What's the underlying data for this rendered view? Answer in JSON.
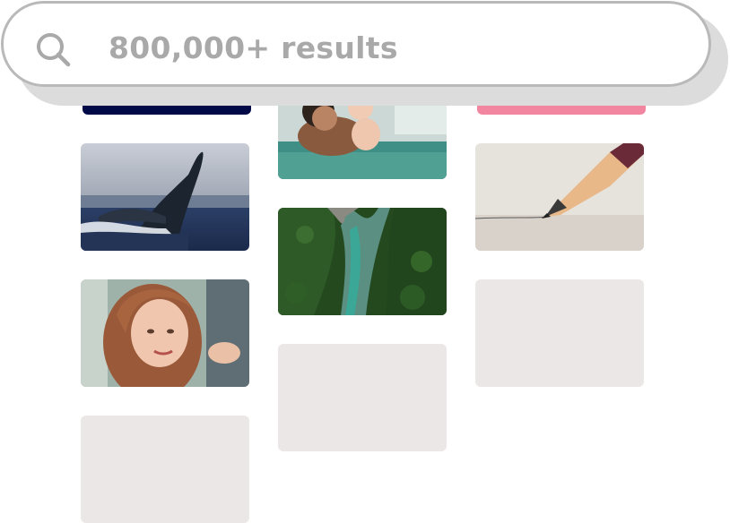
{
  "search": {
    "text": "800,000+ results",
    "icon": "search-icon"
  },
  "tiles": [
    {
      "name": "tile-navy",
      "kind": "color",
      "color": "#000948"
    },
    {
      "name": "tile-pink",
      "kind": "color",
      "color": "#f2859f"
    },
    {
      "name": "tile-whale",
      "kind": "image",
      "subject": "humpback whale breaching"
    },
    {
      "name": "tile-pool",
      "kind": "image",
      "subject": "father and baby in swimming pool"
    },
    {
      "name": "tile-pencil",
      "kind": "image",
      "subject": "pencil drawing a line"
    },
    {
      "name": "tile-river",
      "kind": "image",
      "subject": "aerial view of river through forest"
    },
    {
      "name": "tile-woman",
      "kind": "image",
      "subject": "woman with curly hair at salon"
    },
    {
      "name": "tile-placeholder",
      "kind": "placeholder"
    }
  ]
}
